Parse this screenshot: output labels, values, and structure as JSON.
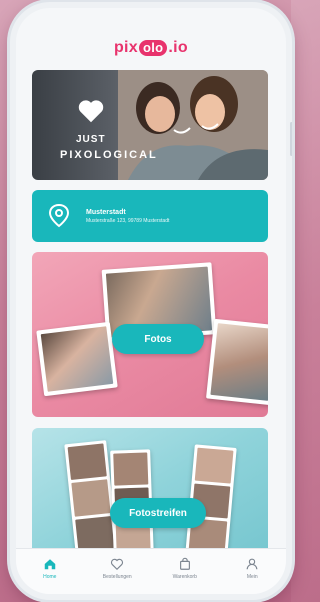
{
  "app": {
    "logo_left": "pix",
    "logo_mid": "olo",
    "logo_right": ".io"
  },
  "hero": {
    "line1": "JUST",
    "line2": "PIXOLOGICAL"
  },
  "info": {
    "title": "Musterstadt",
    "subtitle": "Musterstraße 123, 99789 Musterstadt"
  },
  "fotos": {
    "button_label": "Fotos"
  },
  "streifen": {
    "button_label": "Fotostreifen"
  },
  "nav": [
    {
      "label": "Home",
      "icon": "home-icon",
      "active": true
    },
    {
      "label": "Bestellungen",
      "icon": "heart-icon",
      "active": false
    },
    {
      "label": "Warenkorb",
      "icon": "bag-icon",
      "active": false
    },
    {
      "label": "Mein",
      "icon": "user-icon",
      "active": false
    }
  ],
  "colors": {
    "brand_pink": "#e8336d",
    "teal": "#19b7bb"
  }
}
